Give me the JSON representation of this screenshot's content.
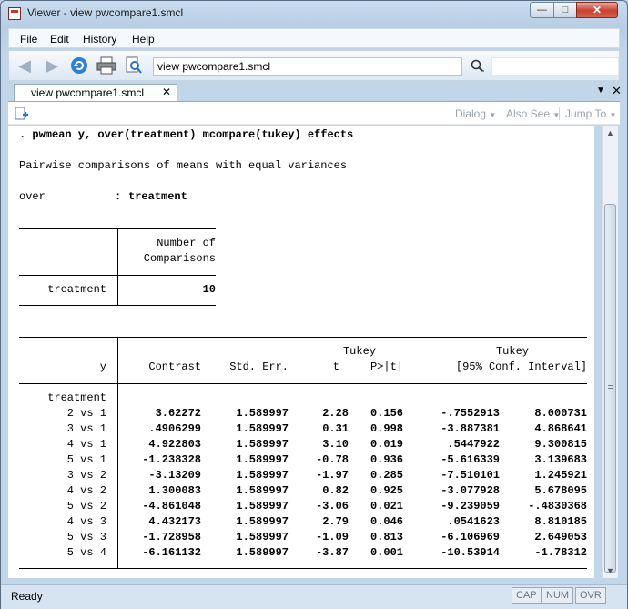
{
  "window": {
    "title": "Viewer - view pwcompare1.smcl"
  },
  "menu": {
    "items": [
      "File",
      "Edit",
      "History",
      "Help"
    ]
  },
  "toolbar": {
    "address": "view pwcompare1.smcl"
  },
  "tab": {
    "label": "view pwcompare1.smcl"
  },
  "viewer_toolbar": {
    "dialog": "Dialog",
    "also_see": "Also See",
    "jump_to": "Jump To"
  },
  "content": {
    "command": ". pwmean y, over(treatment) mcompare(tukey) effects",
    "heading": "Pairwise comparisons of means with equal variances",
    "over_label": "over",
    "over_sep": ":",
    "over_value": "treatment",
    "t1": {
      "header_line1": "Number of",
      "header_line2": "Comparisons",
      "row_label": "treatment",
      "row_value": "10"
    },
    "t2": {
      "tukey1": "Tukey",
      "tukey2": "Tukey",
      "y": "y",
      "contrast": "Contrast",
      "stderr": "Std. Err.",
      "t": "t",
      "p": "P>|t|",
      "ci": "[95% Conf. Interval]",
      "group": "treatment",
      "rows": [
        {
          "label": "2 vs 1",
          "contrast": "3.62272",
          "se": "1.589997",
          "t": "2.28",
          "p": "0.156",
          "lo": "-.7552913",
          "hi": "8.000731"
        },
        {
          "label": "3 vs 1",
          "contrast": ".4906299",
          "se": "1.589997",
          "t": "0.31",
          "p": "0.998",
          "lo": "-3.887381",
          "hi": "4.868641"
        },
        {
          "label": "4 vs 1",
          "contrast": "4.922803",
          "se": "1.589997",
          "t": "3.10",
          "p": "0.019",
          "lo": ".5447922",
          "hi": "9.300815"
        },
        {
          "label": "5 vs 1",
          "contrast": "-1.238328",
          "se": "1.589997",
          "t": "-0.78",
          "p": "0.936",
          "lo": "-5.616339",
          "hi": "3.139683"
        },
        {
          "label": "3 vs 2",
          "contrast": "-3.13209",
          "se": "1.589997",
          "t": "-1.97",
          "p": "0.285",
          "lo": "-7.510101",
          "hi": "1.245921"
        },
        {
          "label": "4 vs 2",
          "contrast": "1.300083",
          "se": "1.589997",
          "t": "0.82",
          "p": "0.925",
          "lo": "-3.077928",
          "hi": "5.678095"
        },
        {
          "label": "5 vs 2",
          "contrast": "-4.861048",
          "se": "1.589997",
          "t": "-3.06",
          "p": "0.021",
          "lo": "-9.239059",
          "hi": "-.4830368"
        },
        {
          "label": "4 vs 3",
          "contrast": "4.432173",
          "se": "1.589997",
          "t": "2.79",
          "p": "0.046",
          "lo": ".0541623",
          "hi": "8.810185"
        },
        {
          "label": "5 vs 3",
          "contrast": "-1.728958",
          "se": "1.589997",
          "t": "-1.09",
          "p": "0.813",
          "lo": "-6.106969",
          "hi": "2.649053"
        },
        {
          "label": "5 vs 4",
          "contrast": "-6.161132",
          "se": "1.589997",
          "t": "-3.87",
          "p": "0.001",
          "lo": "-10.53914",
          "hi": "-1.78312"
        }
      ]
    }
  },
  "status": {
    "text": "Ready",
    "cap": "CAP",
    "num": "NUM",
    "ovr": "OVR"
  }
}
